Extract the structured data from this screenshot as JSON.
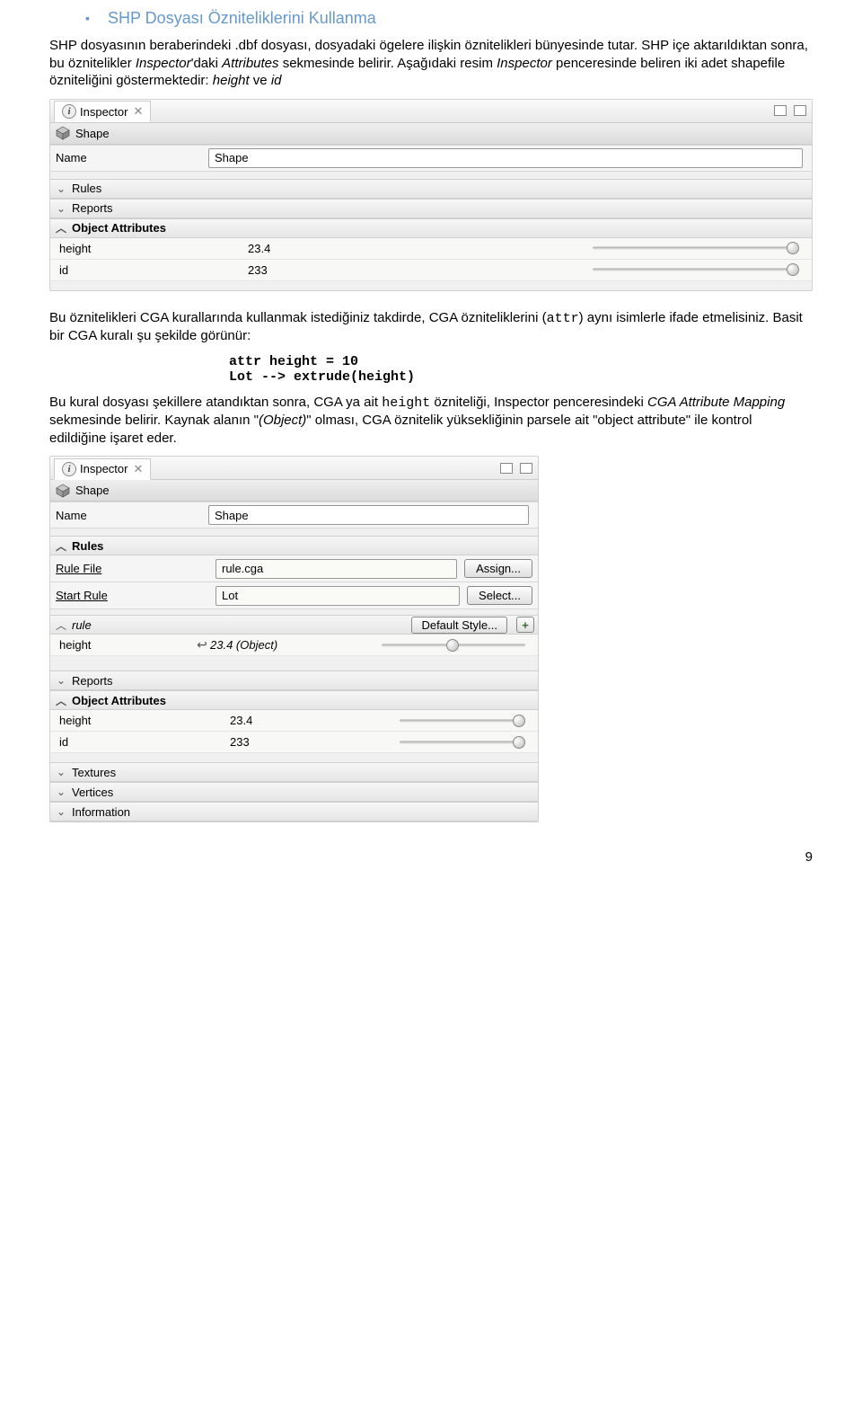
{
  "heading": "SHP Dosyası Özniteliklerini Kullanma",
  "para1": "SHP dosyasının beraberindeki .dbf dosyası, dosyadaki ögelere ilişkin öznitelikleri bünyesinde tutar. SHP içe aktarıldıktan sonra, bu öznitelikler ",
  "para1_i1": "Inspector",
  "para1b": "'daki ",
  "para1_i2": "Attributes",
  "para1c": " sekmesinde belirir. Aşağıdaki resim ",
  "para1_i3": "Inspector",
  "para1d": " penceresinde beliren iki adet shapefile özniteliğini göstermektedir: ",
  "para1_i4": "height",
  "para1e": " ve ",
  "para1_i5": "id",
  "inspector1": {
    "tab": "Inspector",
    "shape_label": "Shape",
    "name_label": "Name",
    "name_value": "Shape",
    "sections": {
      "rules": "Rules",
      "reports": "Reports",
      "object_attributes": "Object Attributes"
    },
    "rows": [
      {
        "label": "height",
        "value": "23.4"
      },
      {
        "label": "id",
        "value": "233"
      }
    ]
  },
  "para2a": "Bu öznitelikleri CGA kurallarında kullanmak istediğiniz takdirde, CGA özniteliklerini (",
  "para2_code": "attr",
  "para2b": ") aynı isimlerle ifade etmelisiniz. Basit bir CGA kuralı şu şekilde görünür:",
  "code1": "attr height = 10",
  "code2": "Lot --> extrude(height)",
  "para3a": "Bu kural dosyası şekillere atandıktan sonra, CGA ya ait ",
  "para3_code": "height",
  "para3b": " özniteliği, Inspector penceresindeki ",
  "para3_i1": "CGA Attribute Mapping",
  "para3c": " sekmesinde belirir. Kaynak alanın \"",
  "para3_i2": "(Object)",
  "para3d": "\" olması, CGA öznitelik yüksekliğinin parsele ait \"object attribute\" ile kontrol edildiğine işaret eder.",
  "inspector2": {
    "tab": "Inspector",
    "shape_label": "Shape",
    "name_label": "Name",
    "name_value": "Shape",
    "sections": {
      "rules": "Rules",
      "reports": "Reports",
      "object_attributes": "Object Attributes",
      "textures": "Textures",
      "vertices": "Vertices",
      "information": "Information",
      "rule": "rule"
    },
    "rule_file_label": "Rule File",
    "rule_file_value": "rule.cga",
    "assign_btn": "Assign...",
    "start_rule_label": "Start Rule",
    "start_rule_value": "Lot",
    "select_btn": "Select...",
    "default_style": "Default Style...",
    "height_row": {
      "label": "height",
      "value": "23.4 (Object)"
    },
    "oa_rows": [
      {
        "label": "height",
        "value": "23.4"
      },
      {
        "label": "id",
        "value": "233"
      }
    ]
  },
  "pagenum": "9"
}
